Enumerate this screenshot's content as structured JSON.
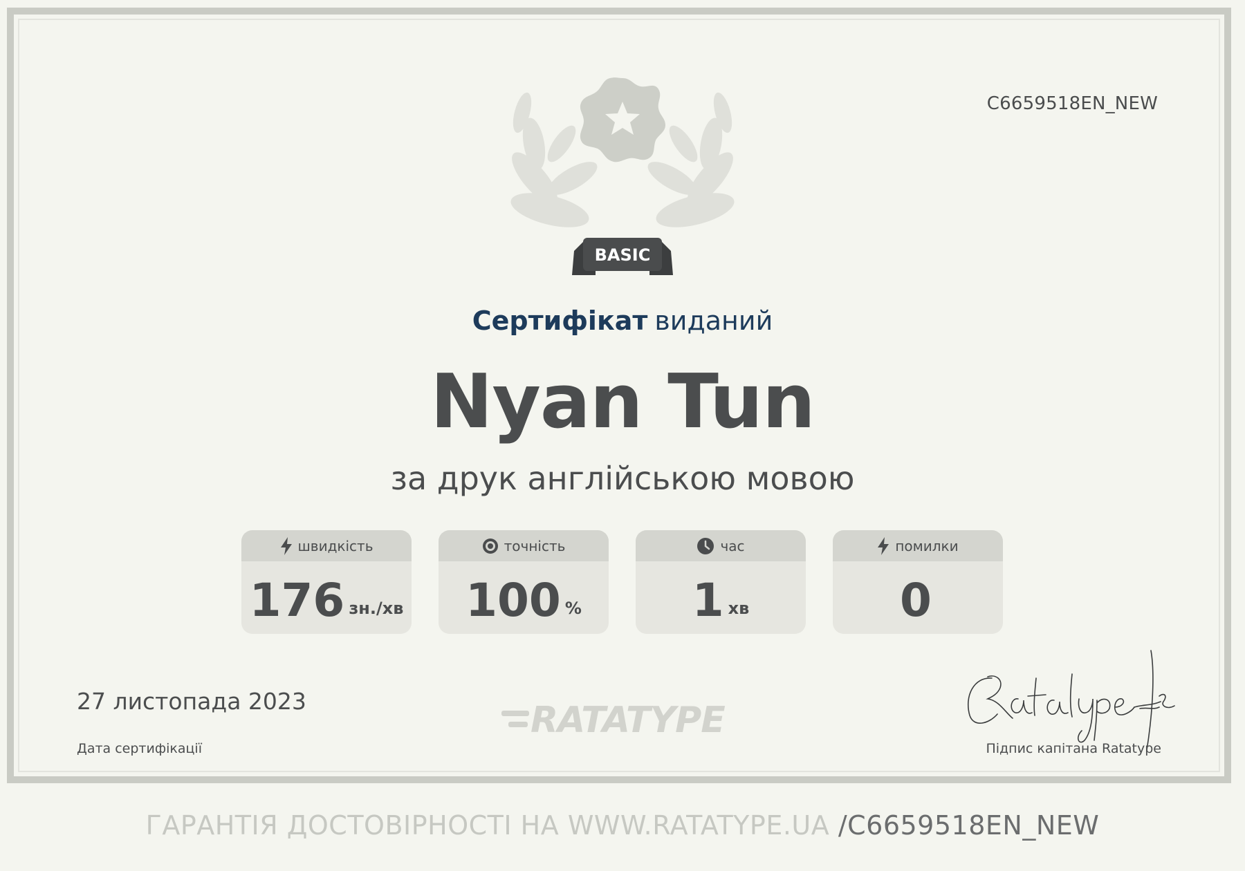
{
  "certificate": {
    "id": "C6659518EN_NEW",
    "badge": "BASIC",
    "headline_strong": "Сертифікат",
    "headline_light": "виданий",
    "recipient": "Nyan Tun",
    "subtitle": "за друк англійською мовою"
  },
  "stats": [
    {
      "label": "швидкість",
      "value": "176",
      "unit": "зн./хв",
      "icon": "lightning-icon"
    },
    {
      "label": "точність",
      "value": "100",
      "unit": "%",
      "icon": "target-icon"
    },
    {
      "label": "час",
      "value": "1",
      "unit": "хв",
      "icon": "clock-icon"
    },
    {
      "label": "помилки",
      "value": "0",
      "unit": "",
      "icon": "lightning-icon"
    }
  ],
  "date": {
    "value": "27 листопада 2023",
    "caption": "Дата сертифікації"
  },
  "logo": {
    "text": "RATATYPE"
  },
  "signature": {
    "caption": "Підпис капітана Ratatype"
  },
  "footer": {
    "prefix": "ГАРАНТІЯ ДОСТОВІРНОСТІ НА WWW.RATATYPE.UA",
    "suffix": "/C6659518EN_NEW"
  },
  "colors": {
    "background": "#f4f5ef",
    "headline": "#1d3b5b",
    "text": "#4b4d4e",
    "stat_card": "#e6e6e0",
    "stat_header": "#d4d5cf",
    "badge_ribbon": "#4a4c4d"
  }
}
